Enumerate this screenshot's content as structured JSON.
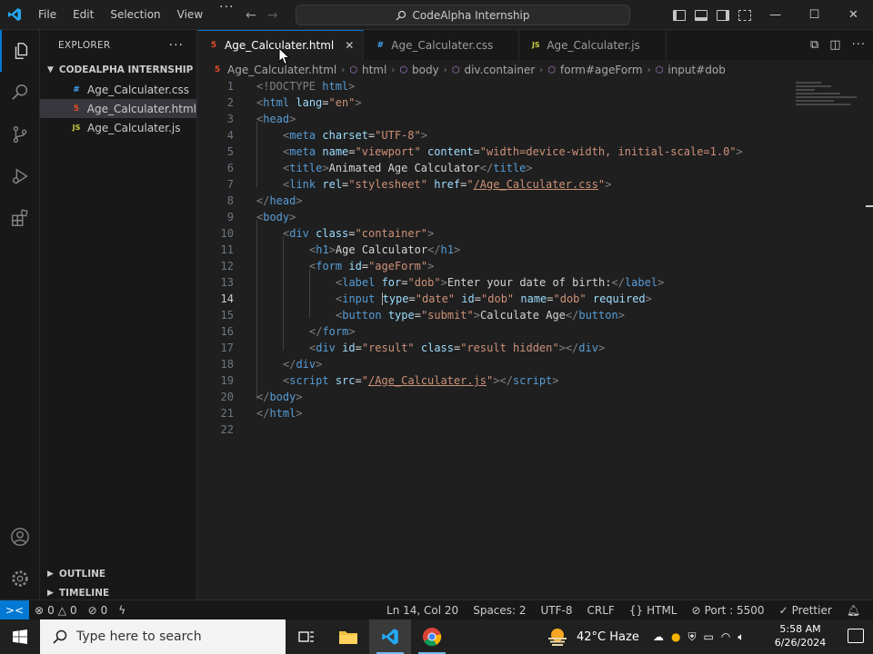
{
  "menu": [
    "File",
    "Edit",
    "Selection",
    "View"
  ],
  "menu_more": "···",
  "command_center": {
    "label": "CodeAlpha Internship"
  },
  "explorer": {
    "title": "EXPLORER",
    "folder": "CODEALPHA INTERNSHIP",
    "files": [
      {
        "name": "Age_Calculater.css",
        "type": "css",
        "icon_label": "#"
      },
      {
        "name": "Age_Calculater.html",
        "type": "html",
        "icon_label": "5"
      },
      {
        "name": "Age_Calculater.js",
        "type": "js",
        "icon_label": "JS"
      }
    ],
    "outline": "OUTLINE",
    "timeline": "TIMELINE"
  },
  "tabs": [
    {
      "label": "Age_Calculater.html",
      "icon": "html-file-icon",
      "icon_label": "5"
    },
    {
      "label": "Age_Calculater.css",
      "icon": "css-file-icon",
      "icon_label": "#"
    },
    {
      "label": "Age_Calculater.js",
      "icon": "js-file-icon",
      "icon_label": "JS"
    }
  ],
  "breadcrumb": [
    "Age_Calculater.html",
    "html",
    "body",
    "div.container",
    "form#ageForm",
    "input#dob"
  ],
  "line_numbers": [
    "1",
    "2",
    "3",
    "4",
    "5",
    "6",
    "7",
    "8",
    "9",
    "10",
    "11",
    "12",
    "13",
    "14",
    "15",
    "16",
    "17",
    "18",
    "19",
    "20",
    "21",
    "22"
  ],
  "code": {
    "l1": [
      "<!DOCTYPE",
      " html",
      ">"
    ],
    "l2": [
      "<",
      "html",
      " lang",
      "=",
      "\"en\"",
      ">"
    ],
    "l3": [
      "<",
      "head",
      ">"
    ],
    "l4": [
      "<",
      "meta",
      " charset",
      "=",
      "\"UTF-8\"",
      ">"
    ],
    "l5": [
      "<",
      "meta",
      " name",
      "=",
      "\"viewport\"",
      " content",
      "=",
      "\"width=device-width, initial-scale=1.0\"",
      ">"
    ],
    "l6": [
      "<",
      "title",
      ">",
      "Animated Age Calculator",
      "</",
      "title",
      ">"
    ],
    "l7": [
      "<",
      "link",
      " rel",
      "=",
      "\"stylesheet\"",
      " href",
      "=",
      "\"",
      "/Age_Calculater.css",
      "\"",
      ">"
    ],
    "l8": [
      "</",
      "head",
      ">"
    ],
    "l9": [
      "<",
      "body",
      ">"
    ],
    "l10": [
      "<",
      "div",
      " class",
      "=",
      "\"container\"",
      ">"
    ],
    "l11": [
      "<",
      "h1",
      ">",
      "Age Calculator",
      "</",
      "h1",
      ">"
    ],
    "l12": [
      "<",
      "form",
      " id",
      "=",
      "\"ageForm\"",
      ">"
    ],
    "l13": [
      "<",
      "label",
      " for",
      "=",
      "\"dob\"",
      ">",
      "Enter your date of birth:",
      "</",
      "label",
      ">"
    ],
    "l14": [
      "<",
      "input",
      " ",
      "type",
      "=",
      "\"date\"",
      " id",
      "=",
      "\"dob\"",
      " name",
      "=",
      "\"dob\"",
      " required",
      ">"
    ],
    "l15": [
      "<",
      "button",
      " type",
      "=",
      "\"submit\"",
      ">",
      "Calculate Age",
      "</",
      "button",
      ">"
    ],
    "l16": [
      "</",
      "form",
      ">"
    ],
    "l17": [
      "<",
      "div",
      " id",
      "=",
      "\"result\"",
      " class",
      "=",
      "\"result hidden\"",
      "></",
      "div",
      ">"
    ],
    "l18": [
      "</",
      "div",
      ">"
    ],
    "l19": [
      "<",
      "script",
      " src",
      "=",
      "\"",
      "/Age_Calculater.js",
      "\"",
      "></",
      "script",
      ">"
    ],
    "l20": [
      "</",
      "body",
      ">"
    ],
    "l21": [
      "</",
      "html",
      ">"
    ]
  },
  "status": {
    "errors": "0",
    "warnings": "0",
    "ports_count": "0",
    "position": "Ln 14, Col 20",
    "spaces": "Spaces: 2",
    "encoding": "UTF-8",
    "eol": "CRLF",
    "language": "HTML",
    "port": "Port : 5500",
    "prettier": "Prettier"
  },
  "taskbar": {
    "search_placeholder": "Type here to search",
    "weather": "42°C  Haze",
    "time": "5:58 AM",
    "date": "6/26/2024"
  },
  "colors": {
    "accent": "#0078d4",
    "html_tag": "#569cd6",
    "attribute": "#9cdcfe",
    "string": "#ce9178"
  }
}
